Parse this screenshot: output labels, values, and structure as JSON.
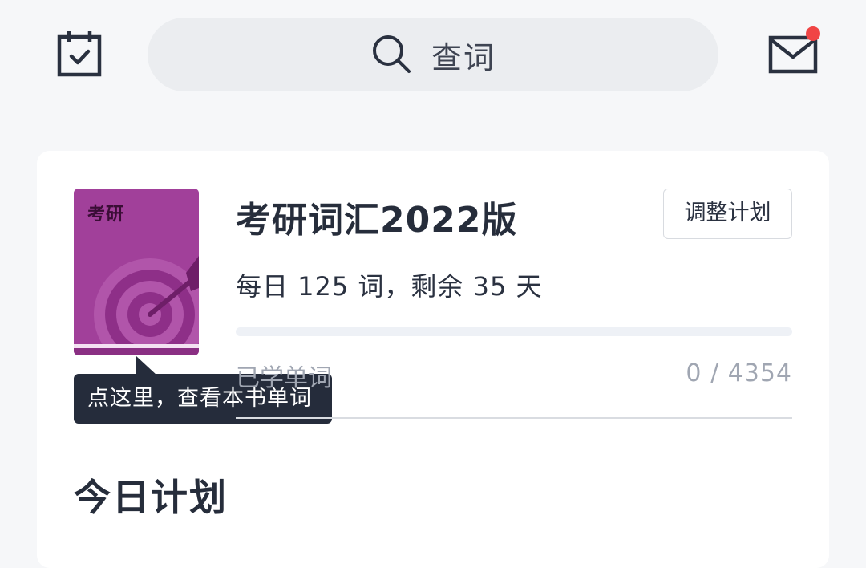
{
  "header": {
    "calendar_icon": "calendar-check-icon",
    "search": {
      "label": "查词",
      "icon": "search-icon"
    },
    "mail": {
      "icon": "mail-icon",
      "has_unread": true,
      "dot_color": "#f04545"
    }
  },
  "book": {
    "cover_title": "考研",
    "title": "考研词汇2022版",
    "adjust_button": "调整计划",
    "daily_plan": "每日 125 词，剩余 35 天",
    "learned_label": "已学单词",
    "learned_count": "0 / 4354",
    "progress": 0,
    "tooltip": "点这里，查看本书单词",
    "cover_color": "#a1409a"
  },
  "today": {
    "section_title": "今日计划"
  }
}
